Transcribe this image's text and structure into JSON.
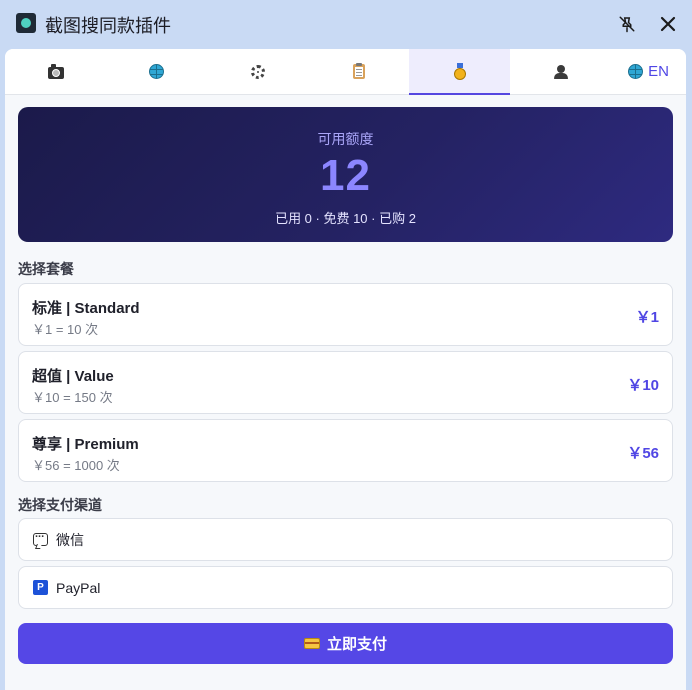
{
  "window": {
    "title": "截图搜同款插件",
    "pin_icon": "pin-off-icon",
    "close_icon": "close-icon"
  },
  "tabs": [
    {
      "icon": "camera-icon",
      "active": false
    },
    {
      "icon": "globe-icon",
      "active": false
    },
    {
      "icon": "gear-icon",
      "active": false
    },
    {
      "icon": "clipboard-icon",
      "active": false
    },
    {
      "icon": "medal-icon",
      "active": true
    },
    {
      "icon": "user-icon",
      "active": false
    }
  ],
  "language": {
    "icon": "globe-icon",
    "label": "EN"
  },
  "quota": {
    "label": "可用额度",
    "value": "12",
    "details": "已用 0 · 免费 10 · 已购 2"
  },
  "plans": {
    "title": "选择套餐",
    "items": [
      {
        "name": "标准 | Standard",
        "desc": "￥1 = 10 次",
        "price": "￥1"
      },
      {
        "name": "超值 | Value",
        "desc": "￥10 = 150 次",
        "price": "￥10"
      },
      {
        "name": "尊享 | Premium",
        "desc": "￥56 = 1000 次",
        "price": "￥56"
      }
    ]
  },
  "payment": {
    "title": "选择支付渠道",
    "methods": [
      {
        "icon": "wechat-icon",
        "label": "微信"
      },
      {
        "icon": "paypal-icon",
        "label": "PayPal"
      }
    ],
    "submit_label": "立即支付",
    "submit_icon": "credit-card-icon"
  },
  "colors": {
    "accent": "#5547e6",
    "quota_card_bg": "#242262",
    "window_bg": "#c9daf4"
  }
}
